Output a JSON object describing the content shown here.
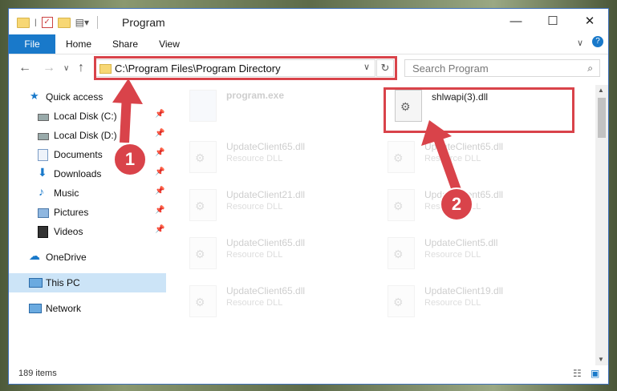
{
  "window": {
    "title": "Program"
  },
  "ribbon": {
    "tabs": [
      "File",
      "Home",
      "Share",
      "View"
    ]
  },
  "address": {
    "path": "C:\\Program Files\\Program Directory"
  },
  "search": {
    "placeholder": "Search Program"
  },
  "sidebar": {
    "items": [
      {
        "label": "Quick access",
        "icon": "star-icon"
      },
      {
        "label": "Local Disk (C:)",
        "icon": "drive-icon",
        "pinned": true
      },
      {
        "label": "Local Disk (D:)",
        "icon": "drive-icon",
        "pinned": true
      },
      {
        "label": "Documents",
        "icon": "documents-icon",
        "pinned": true
      },
      {
        "label": "Downloads",
        "icon": "download-icon",
        "pinned": true
      },
      {
        "label": "Music",
        "icon": "music-icon",
        "pinned": true
      },
      {
        "label": "Pictures",
        "icon": "pictures-icon",
        "pinned": true
      },
      {
        "label": "Videos",
        "icon": "videos-icon",
        "pinned": true
      },
      {
        "label": "OneDrive",
        "icon": "cloud-icon"
      },
      {
        "label": "This PC",
        "icon": "computer-icon",
        "selected": true
      },
      {
        "label": "Network",
        "icon": "network-icon"
      }
    ]
  },
  "files": [
    {
      "name": "program.exe",
      "type": ""
    },
    {
      "name": "shlwapi(3).dll",
      "type": ""
    },
    {
      "name": "UpdateClient65.dll",
      "type": "Resource DLL"
    },
    {
      "name": "UpdateClient65.dll",
      "type": "Resource DLL"
    },
    {
      "name": "UpdateClient21.dll",
      "type": "Resource DLL"
    },
    {
      "name": "UpdateClient65.dll",
      "type": "Resource DLL"
    },
    {
      "name": "UpdateClient65.dll",
      "type": "Resource DLL"
    },
    {
      "name": "UpdateClient5.dll",
      "type": "Resource DLL"
    },
    {
      "name": "UpdateClient65.dll",
      "type": "Resource DLL"
    },
    {
      "name": "UpdateClient19.dll",
      "type": "Resource DLL"
    }
  ],
  "status": {
    "items": "189 items"
  },
  "annotations": {
    "step1": "1",
    "step2": "2",
    "color": "#d9434a"
  }
}
